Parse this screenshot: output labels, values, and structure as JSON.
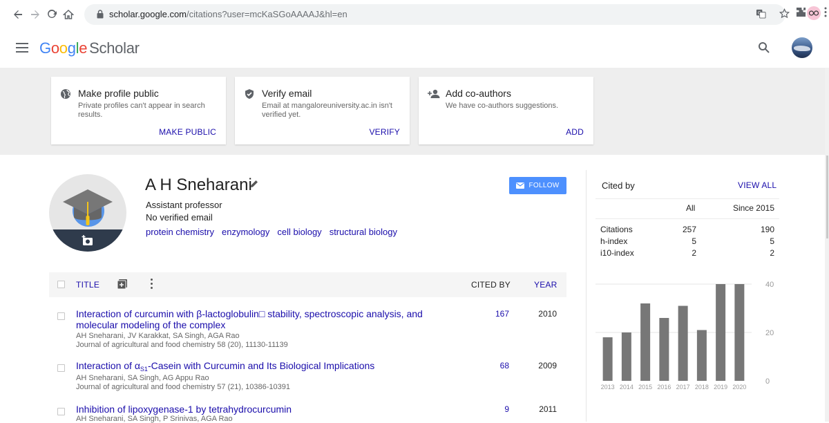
{
  "browser": {
    "url_host": "scholar.google.com",
    "url_path": "/citations?user=mcKaSGoAAAAJ&hl=en",
    "icons": [
      "back-arrow-icon",
      "forward-arrow-icon",
      "reload-icon",
      "home-icon",
      "lock-icon",
      "translate-icon",
      "star-icon",
      "extensions-icon",
      "profile-icon",
      "menu-icon"
    ]
  },
  "header": {
    "logo_google": "Google",
    "logo_scholar": "Scholar"
  },
  "cards": [
    {
      "title": "Make profile public",
      "desc": "Private profiles can't appear in search results.",
      "action": "MAKE PUBLIC",
      "icon": "globe-icon"
    },
    {
      "title": "Verify email",
      "desc": "Email at mangaloreuniversity.ac.in isn't verified yet.",
      "action": "VERIFY",
      "icon": "shield-check-icon"
    },
    {
      "title": "Add co-authors",
      "desc": "We have co-authors suggestions.",
      "action": "ADD",
      "icon": "add-person-icon"
    }
  ],
  "profile": {
    "name": "A H Sneharani",
    "affiliation": "Assistant professor",
    "email": "No verified email",
    "interests": [
      "protein chemistry",
      "enzymology",
      "cell biology",
      "structural biology"
    ],
    "follow_label": "FOLLOW"
  },
  "table": {
    "header_title": "TITLE",
    "header_cited": "CITED BY",
    "header_year": "YEAR",
    "rows": [
      {
        "title": "Interaction of curcumin with β-lactoglobulin□ stability, spectroscopic analysis, and molecular modeling of the complex",
        "authors": "AH Sneharani, JV Karakkat, SA Singh, AGA Rao",
        "venue": "Journal of agricultural and food chemistry 58 (20), 11130-11139",
        "cited_by": "167",
        "year": "2010"
      },
      {
        "title_pre": "Interaction of α",
        "title_sub": "S1",
        "title_post": "-Casein with Curcumin and Its Biological Implications",
        "authors": "AH Sneharani, SA Singh, AG Appu Rao",
        "venue": "Journal of agricultural and food chemistry 57 (21), 10386-10391",
        "cited_by": "68",
        "year": "2009"
      },
      {
        "title": "Inhibition of lipoxygenase-1 by tetrahydrocurcumin",
        "authors": "AH Sneharani, SA Singh, P Srinivas, AGA Rao",
        "venue": "",
        "cited_by": "9",
        "year": "2011"
      }
    ]
  },
  "cited_by": {
    "title": "Cited by",
    "view_all": "VIEW ALL",
    "col_all": "All",
    "col_since": "Since 2015",
    "metrics": [
      {
        "label": "Citations",
        "all": "257",
        "since": "190"
      },
      {
        "label": "h-index",
        "all": "5",
        "since": "5"
      },
      {
        "label": "i10-index",
        "all": "2",
        "since": "2"
      }
    ]
  },
  "chart_data": {
    "type": "bar",
    "categories": [
      "2013",
      "2014",
      "2015",
      "2016",
      "2017",
      "2018",
      "2019",
      "2020"
    ],
    "values": [
      18,
      20,
      32,
      26,
      31,
      21,
      40,
      40
    ],
    "ylim": [
      0,
      40
    ],
    "yticks": [
      "0",
      "20",
      "40"
    ],
    "bar_color": "#777777",
    "grid": true
  }
}
